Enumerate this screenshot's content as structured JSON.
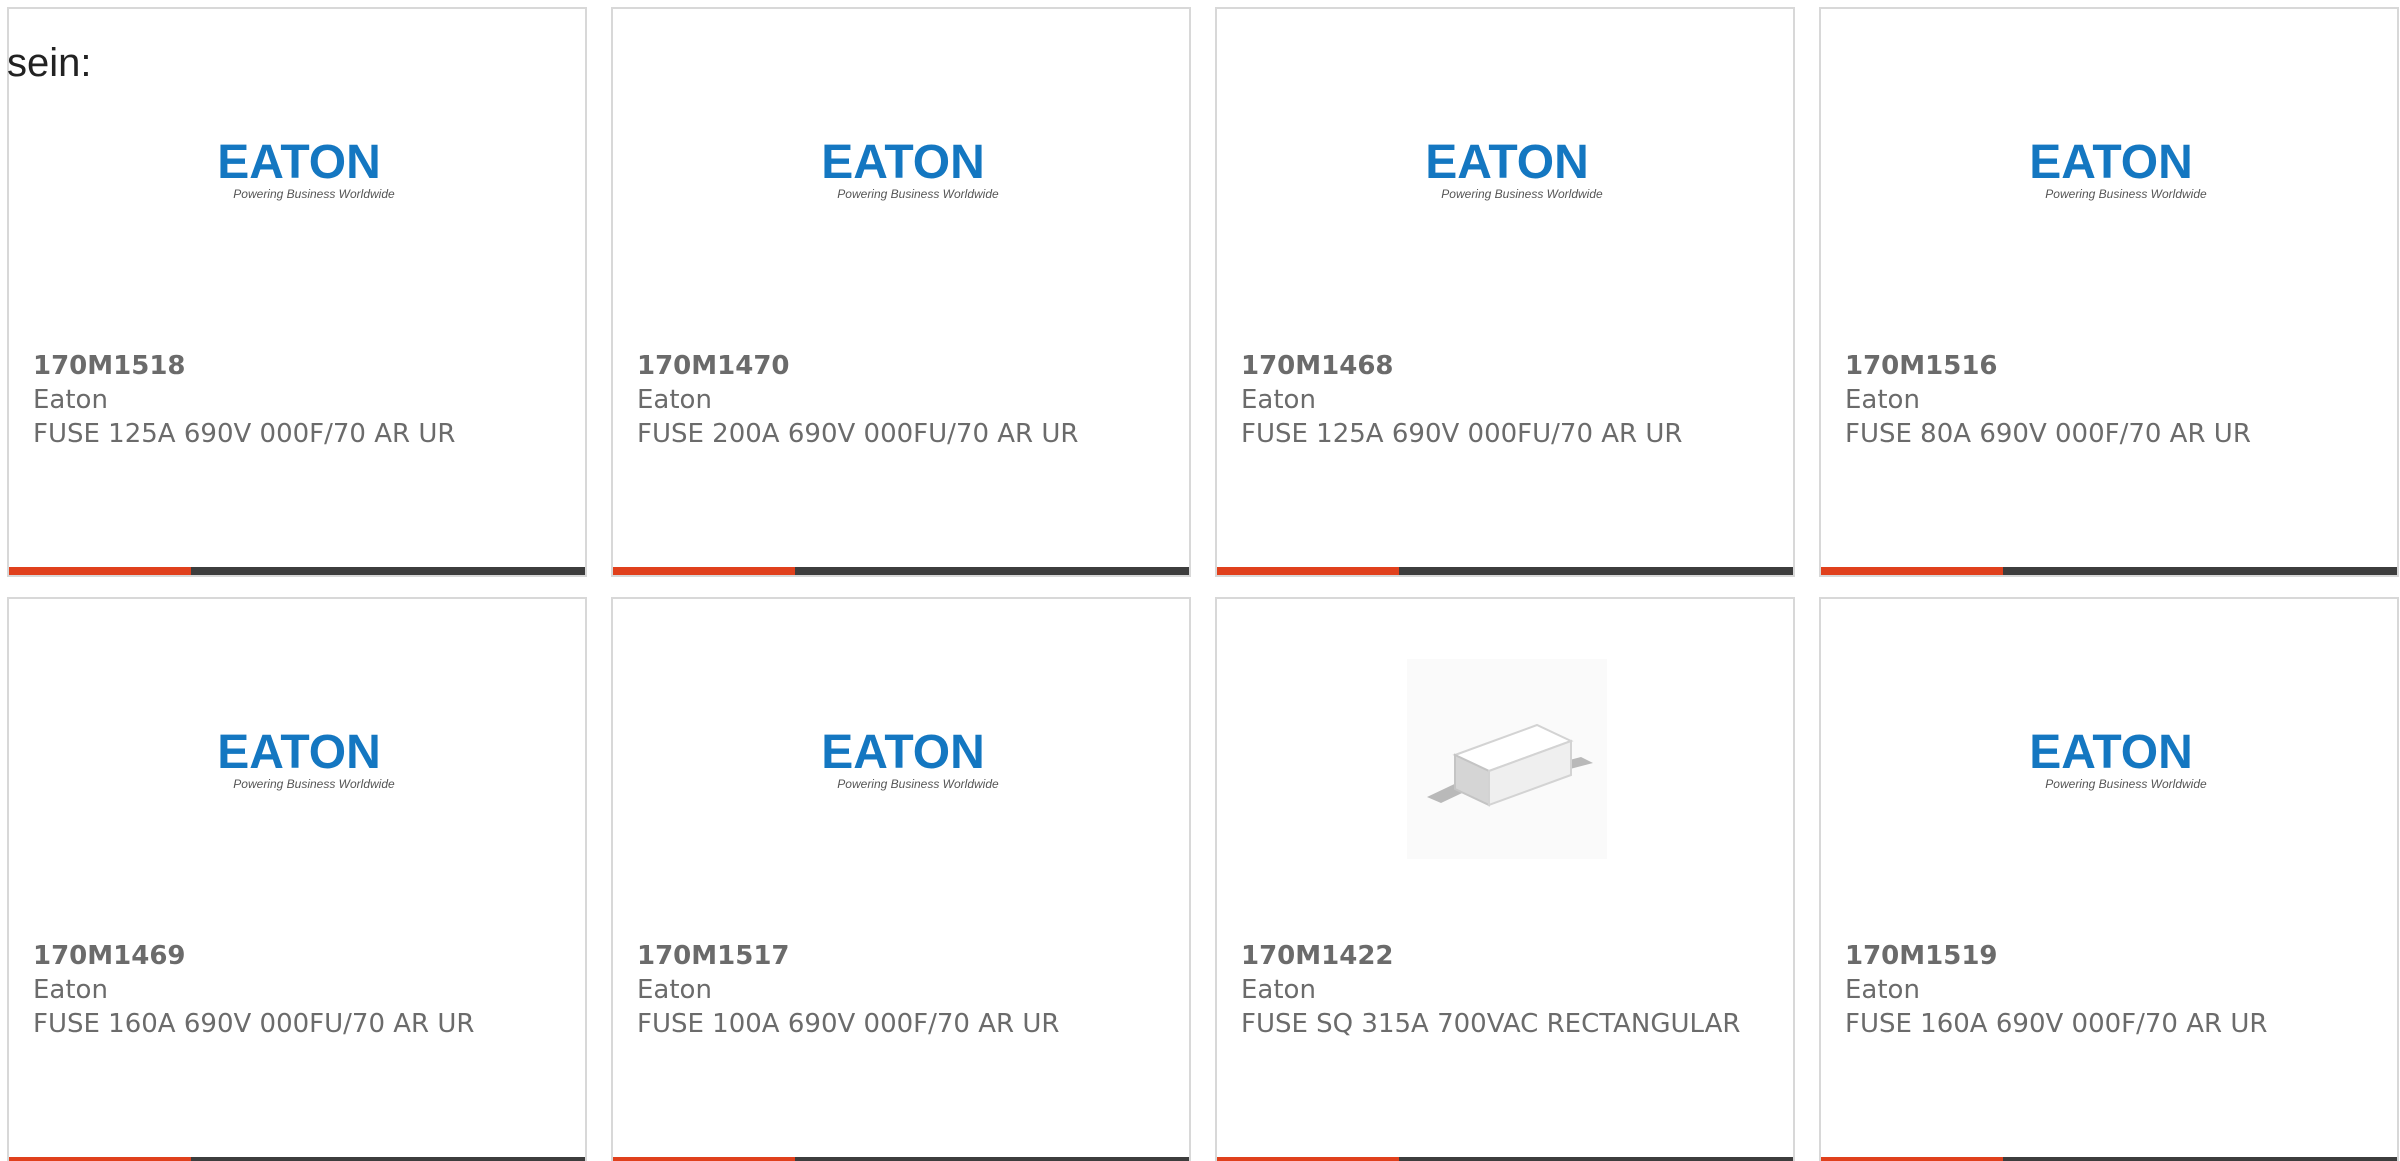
{
  "intro_text": "sein:",
  "theme": {
    "accent": "#e0401c",
    "bar_dark": "#3d3d3d",
    "brand_blue": "#1477c1",
    "text_gray": "#6b6b6b"
  },
  "brand_logo": {
    "text": "EATON",
    "tagline": "Powering Business Worldwide"
  },
  "products": [
    {
      "part": "170M1518",
      "maker": "Eaton",
      "description": "FUSE 125A 690V 000F/70 AR UR",
      "image": "eaton-logo"
    },
    {
      "part": "170M1470",
      "maker": "Eaton",
      "description": "FUSE 200A 690V 000FU/70 AR UR",
      "image": "eaton-logo"
    },
    {
      "part": "170M1468",
      "maker": "Eaton",
      "description": "FUSE 125A 690V 000FU/70 AR UR",
      "image": "eaton-logo"
    },
    {
      "part": "170M1516",
      "maker": "Eaton",
      "description": "FUSE 80A 690V 000F/70 AR UR",
      "image": "eaton-logo"
    },
    {
      "part": "170M1469",
      "maker": "Eaton",
      "description": "FUSE 160A 690V 000FU/70 AR UR",
      "image": "eaton-logo"
    },
    {
      "part": "170M1517",
      "maker": "Eaton",
      "description": "FUSE 100A 690V 000F/70 AR UR",
      "image": "eaton-logo"
    },
    {
      "part": "170M1422",
      "maker": "Eaton",
      "description": "FUSE SQ 315A 700VAC RECTANGULAR",
      "image": "fuse-product-photo"
    },
    {
      "part": "170M1519",
      "maker": "Eaton",
      "description": "FUSE 160A 690V 000F/70 AR UR",
      "image": "eaton-logo"
    }
  ]
}
